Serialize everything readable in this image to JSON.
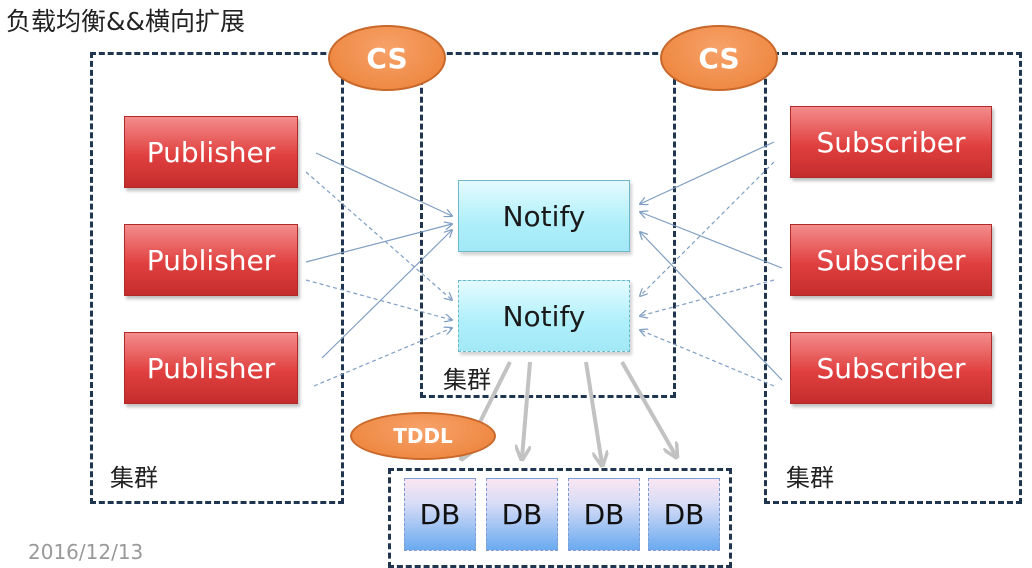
{
  "title": "负载均衡&&横向扩展",
  "cs_label": "CS",
  "tddl_label": "TDDL",
  "cluster_label": "集群",
  "publishers": [
    "Publisher",
    "Publisher",
    "Publisher"
  ],
  "subscribers": [
    "Subscriber",
    "Subscriber",
    "Subscriber"
  ],
  "notify": [
    "Notify",
    "Notify"
  ],
  "dbs": [
    "DB",
    "DB",
    "DB",
    "DB"
  ],
  "footer_date": "2016/12/13",
  "colors": {
    "publisher": "#e0403f",
    "notify": "#aeeffa",
    "cs_ellipse": "#ef8a45",
    "db": "#6aaaf0",
    "cluster_border": "#1f3550",
    "arrow": "#7f9ec2",
    "db_arrow": "#c2c2c2"
  }
}
